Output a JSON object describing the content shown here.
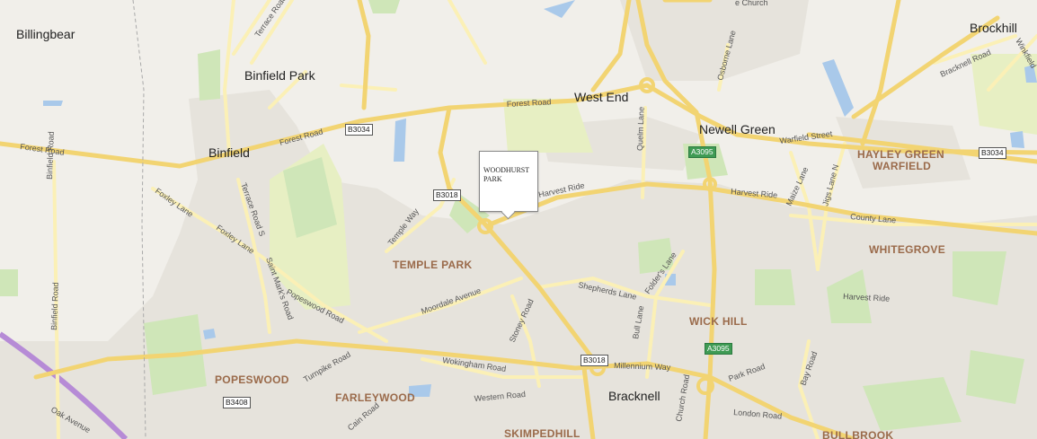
{
  "map": {
    "colors": {
      "background": "#f1efea",
      "park": "#cfe6b8",
      "field": "#e7efc3",
      "water": "#a9c9ea",
      "major_road": "#f2d472",
      "minor_road": "#fbf0b6",
      "urban": "#e6e3dc",
      "motorway": "#b68bd6"
    },
    "places": [
      {
        "id": "billingbear",
        "label": "Billingbear"
      },
      {
        "id": "binfield-park",
        "label": "Binfield Park"
      },
      {
        "id": "binfield",
        "label": "Binfield"
      },
      {
        "id": "west-end",
        "label": "West End"
      },
      {
        "id": "newell-green",
        "label": "Newell Green"
      },
      {
        "id": "brockhill",
        "label": "Brockhill"
      },
      {
        "id": "bracknell",
        "label": "Bracknell"
      }
    ],
    "districts": [
      {
        "id": "hayley-green",
        "label": "HAYLEY GREEN"
      },
      {
        "id": "warfield",
        "label": "WARFIELD"
      },
      {
        "id": "whitegrove",
        "label": "WHITEGROVE"
      },
      {
        "id": "temple-park",
        "label": "TEMPLE PARK"
      },
      {
        "id": "wick-hill",
        "label": "WICK HILL"
      },
      {
        "id": "popeswood",
        "label": "POPESWOOD"
      },
      {
        "id": "farleywood",
        "label": "FARLEYWOOD"
      },
      {
        "id": "skimpedhill",
        "label": "SKIMPEDHILL"
      },
      {
        "id": "bullbrook",
        "label": "BULLBROOK"
      }
    ],
    "road_shields": [
      {
        "id": "b3034-west",
        "label": "B3034",
        "style": "white"
      },
      {
        "id": "b3034-east",
        "label": "B3034",
        "style": "white"
      },
      {
        "id": "b3018-north",
        "label": "B3018",
        "style": "white"
      },
      {
        "id": "b3018-south",
        "label": "B3018",
        "style": "white"
      },
      {
        "id": "b3408",
        "label": "B3408",
        "style": "white"
      },
      {
        "id": "a3095-north",
        "label": "A3095",
        "style": "green"
      },
      {
        "id": "a3095-south",
        "label": "A3095",
        "style": "green"
      }
    ],
    "streets": [
      {
        "id": "forest-road-west",
        "label": "Forest Road"
      },
      {
        "id": "forest-road-mid",
        "label": "Forest Road"
      },
      {
        "id": "forest-road-north",
        "label": "Forest Road"
      },
      {
        "id": "terrace-road-n-top",
        "label": "Terrace Road N"
      },
      {
        "id": "terrace-road-s",
        "label": "Terrace Road S"
      },
      {
        "id": "binfield-road-north",
        "label": "Binfield Road"
      },
      {
        "id": "binfield-road-south",
        "label": "Binfield Road"
      },
      {
        "id": "foxley-lane-west",
        "label": "Foxley Lane"
      },
      {
        "id": "foxley-lane-east",
        "label": "Foxley Lane"
      },
      {
        "id": "temple-way",
        "label": "Temple Way"
      },
      {
        "id": "saint-marks-road",
        "label": "Saint Mark's Road"
      },
      {
        "id": "popeswood-road",
        "label": "Popeswood Road"
      },
      {
        "id": "moordale-avenue",
        "label": "Moordale Avenue"
      },
      {
        "id": "wokingham-road",
        "label": "Wokingham Road"
      },
      {
        "id": "stoney-road",
        "label": "Stoney Road"
      },
      {
        "id": "western-road",
        "label": "Western Road"
      },
      {
        "id": "turnpike-road",
        "label": "Turnpike Road"
      },
      {
        "id": "cain-road",
        "label": "Cain Road"
      },
      {
        "id": "oak-avenue",
        "label": "Oak Avenue"
      },
      {
        "id": "harvest-ride-west",
        "label": "Harvest Ride"
      },
      {
        "id": "harvest-ride-mid",
        "label": "Harvest Ride"
      },
      {
        "id": "harvest-ride-east",
        "label": "Harvest Ride"
      },
      {
        "id": "shepherds-lane",
        "label": "Shepherds Lane"
      },
      {
        "id": "folders-lane",
        "label": "Folder's Lane"
      },
      {
        "id": "bull-lane",
        "label": "Bull Lane"
      },
      {
        "id": "millennium-way",
        "label": "Millennium Way"
      },
      {
        "id": "church-road",
        "label": "Church Road"
      },
      {
        "id": "park-road",
        "label": "Park Road"
      },
      {
        "id": "london-road",
        "label": "London Road"
      },
      {
        "id": "bay-road",
        "label": "Bay Road"
      },
      {
        "id": "osborne-lane",
        "label": "Osborne Lane"
      },
      {
        "id": "warfield-street",
        "label": "Warfield Street"
      },
      {
        "id": "maize-lane",
        "label": "Maize Lane"
      },
      {
        "id": "jigs-lane-n",
        "label": "Jigs Lane N"
      },
      {
        "id": "county-lane",
        "label": "County Lane"
      },
      {
        "id": "bracknell-road",
        "label": "Bracknell Road"
      },
      {
        "id": "winkfield",
        "label": "Winkfield"
      },
      {
        "id": "church-lane-top",
        "label": "e Church"
      },
      {
        "id": "quelm-lane",
        "label": "Quelm Lane"
      }
    ],
    "marker": {
      "label": "WOODHURST PARK"
    }
  }
}
